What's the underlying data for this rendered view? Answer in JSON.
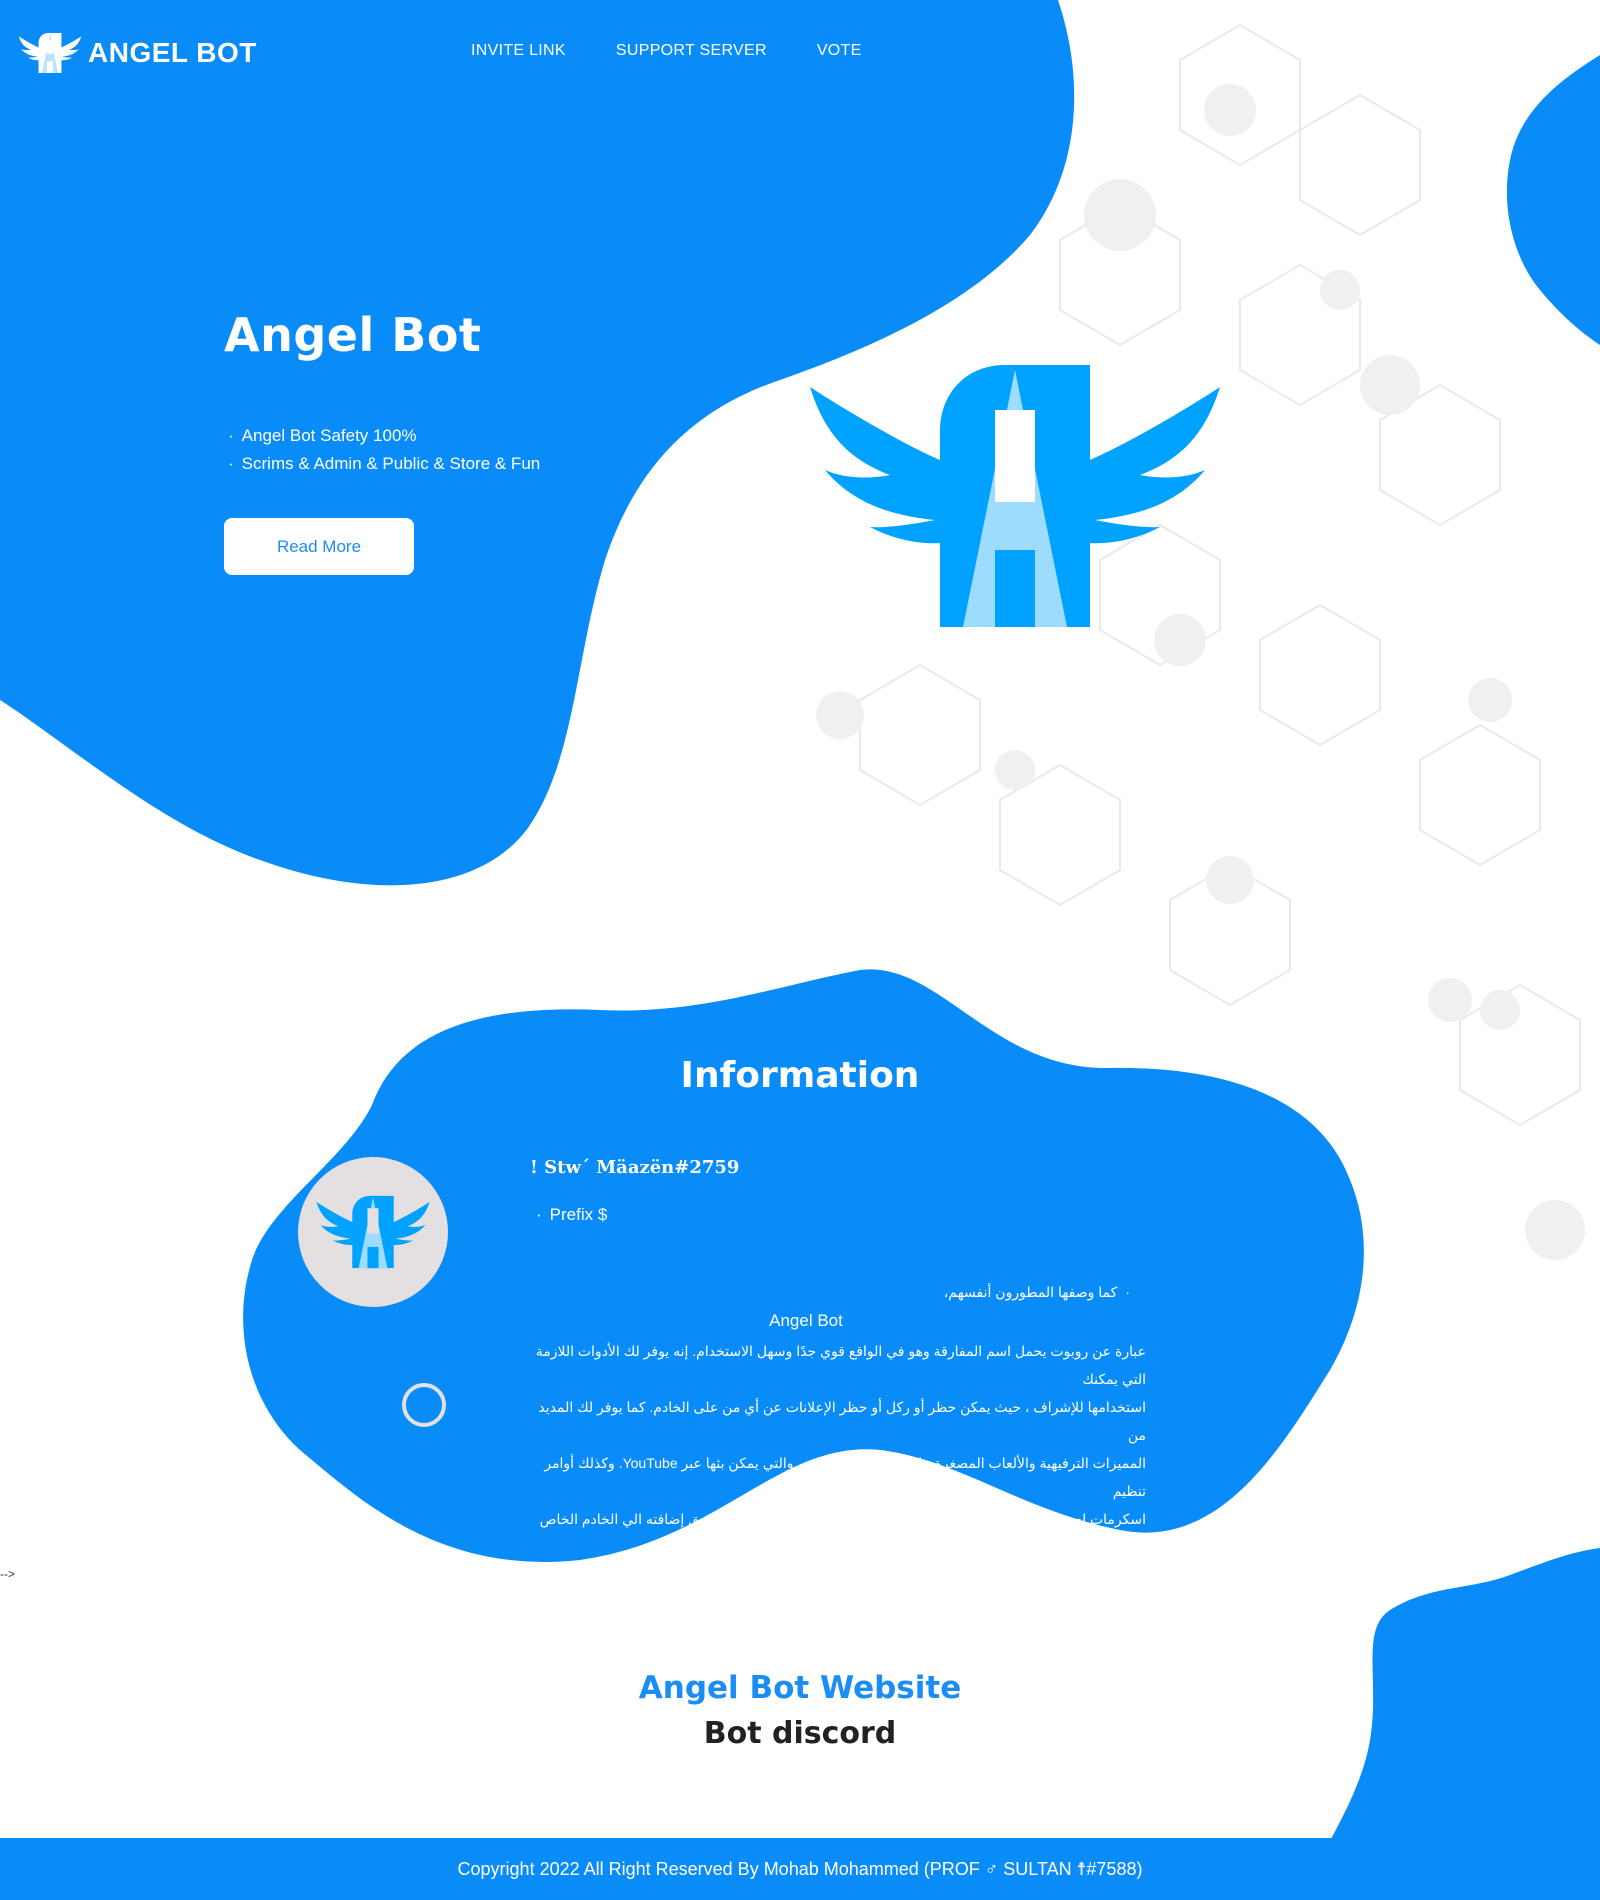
{
  "brand": {
    "name": "ANGEL BOT",
    "logo_icon": "winged-a-icon"
  },
  "nav": {
    "items": [
      {
        "label": "INVITE LINK"
      },
      {
        "label": "SUPPORT SERVER"
      },
      {
        "label": "VOTE"
      }
    ]
  },
  "hero": {
    "title": "Angel Bot",
    "features": [
      "Angel Bot Safety 100%",
      "Scrims & Admin & Public & Store & Fun"
    ],
    "button_label": "Read More",
    "logo_icon": "winged-a-icon"
  },
  "info": {
    "title": "Information",
    "username": "! Stw´ Mäazën#2759",
    "prefix": "Prefix $",
    "note": "كما وصفها المطورون أنفسهم،",
    "bot_name": "Angel Bot",
    "description_lines": [
      "عبارة عن روبوت يحمل اسم المفارقة وهو في الواقع قوي جدًا وسهل الاستخدام. إنه يوفر لك الأدوات اللازمة التي يمكنك",
      "استخدامها للإشراف ، حيث يمكن حظر أو ركل أو حظر الإعلانات عن أي من على الخادم. كما يوفر لك المديد من",
      "المميزات الترفيهية والألعاب المصغرة ، إلى جانب الموسيقى ، والتي يمكن بثها عبر YouTube. وكذلك أوامر تنظيم",
      "اسكرمات لعبه ببجي موبيل وأشياء آخره رائعه يمكنك تجربه البوت الان عن طريق إضافته الي الخادم الخاص بك"
    ]
  },
  "stray_text": "-->",
  "site": {
    "title": "Angel Bot Website",
    "subtitle": "Bot discord"
  },
  "footer": {
    "copyright": "Copyright 2022 All Right Reserved By Mohab Mohammed (PROF ♂ SULTAN ☨#7588)"
  },
  "colors": {
    "primary_blue": "#098cf7",
    "logo_blue": "#00a2ff",
    "logo_light": "#9edcff",
    "avatar_bg": "#e4e0e1"
  }
}
